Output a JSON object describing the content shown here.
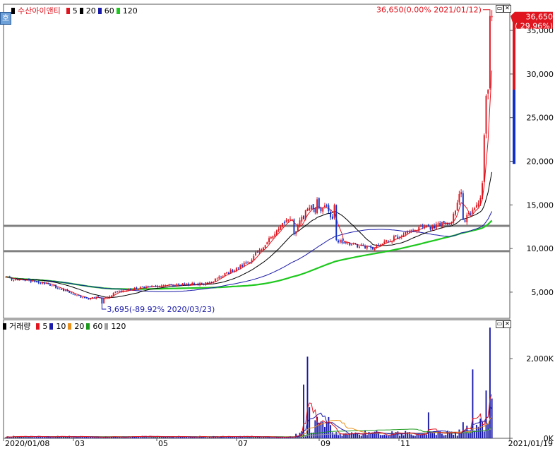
{
  "colors": {
    "candle_up": "#e0141e",
    "candle_down": "#1030c8",
    "ma5": "#e0141e",
    "ma20": "#000000",
    "ma60": "#1a1aaa",
    "ma120": "#1ec81e",
    "vma10": "#1a1aaa",
    "vma20": "#e8901a",
    "vma60": "#1e9a1e",
    "vma120": "#a0a0a0",
    "hline": "#808080",
    "annot": "#1a1aaa"
  },
  "price_pane": {
    "legend": {
      "title": "수산아이앤티",
      "items": [
        {
          "label": "5",
          "color": "#e0141e"
        },
        {
          "label": "20",
          "color": "#000000"
        },
        {
          "label": "60",
          "color": "#1a1aaa"
        },
        {
          "label": "120",
          "color": "#1ec81e"
        }
      ]
    },
    "mode_icon": "호",
    "y_ticks": [
      "5,000",
      "10,000",
      "15,000",
      "20,000",
      "25,000",
      "30,000",
      "35,000"
    ],
    "current": {
      "price": "36,650",
      "change": "( 29.96%)"
    },
    "high_annotation": "36,650(0.00% 2021/01/12)",
    "low_annotation": "3,695(-89.92% 2020/03/23)",
    "hlines": [
      12600,
      9700
    ]
  },
  "volume_pane": {
    "legend": {
      "title": "거래량",
      "items": [
        {
          "label": "5",
          "color": "#e0141e"
        },
        {
          "label": "10",
          "color": "#1a1aaa"
        },
        {
          "label": "20",
          "color": "#e8901a"
        },
        {
          "label": "60",
          "color": "#1e9a1e"
        },
        {
          "label": "120",
          "color": "#a0a0a0"
        }
      ]
    },
    "y_ticks": [
      "0K",
      "2,000K"
    ]
  },
  "x_labels": [
    "2020/01/08",
    "03",
    "05",
    "07",
    "09",
    "11",
    "2021/01/19"
  ],
  "chart_data": {
    "type": "candlestick",
    "title": "수산아이앤티",
    "period": [
      "2020/01/08",
      "2021/01/19"
    ],
    "price_ylim": [
      2000,
      38000
    ],
    "volume_ylim": [
      0,
      2800
    ],
    "volume_unit": "K",
    "monthly_closes": [
      {
        "month": "2020/01",
        "close": 6600
      },
      {
        "month": "2020/02",
        "close": 6000
      },
      {
        "month": "2020/03",
        "close": 4200
      },
      {
        "month": "2020/04",
        "close": 5300
      },
      {
        "month": "2020/05",
        "close": 5800
      },
      {
        "month": "2020/06",
        "close": 6000
      },
      {
        "month": "2020/07",
        "close": 8500
      },
      {
        "month": "2020/08",
        "close": 13500
      },
      {
        "month": "2020/09",
        "close": 11000
      },
      {
        "month": "2020/10",
        "close": 10000
      },
      {
        "month": "2020/11",
        "close": 12000
      },
      {
        "month": "2020/12",
        "close": 13000
      },
      {
        "month": "2021/01",
        "close": 28200
      }
    ],
    "last_close": 36650,
    "last_change_pct": 29.96,
    "period_high": {
      "value": 36650,
      "pct": 0.0,
      "date": "2021/01/12"
    },
    "period_low": {
      "value": 3695,
      "pct": -89.92,
      "date": "2020/03/23"
    },
    "volume_peaks": [
      {
        "month": "2020/08",
        "value": 2050
      },
      {
        "month": "2020/12",
        "value": 1730
      },
      {
        "month": "2021/01",
        "value": 2780
      }
    ],
    "series": [
      {
        "name": "5",
        "kind": "ma"
      },
      {
        "name": "20",
        "kind": "ma"
      },
      {
        "name": "60",
        "kind": "ma"
      },
      {
        "name": "120",
        "kind": "ma"
      }
    ],
    "legend_position": "top-left",
    "grid": false
  }
}
